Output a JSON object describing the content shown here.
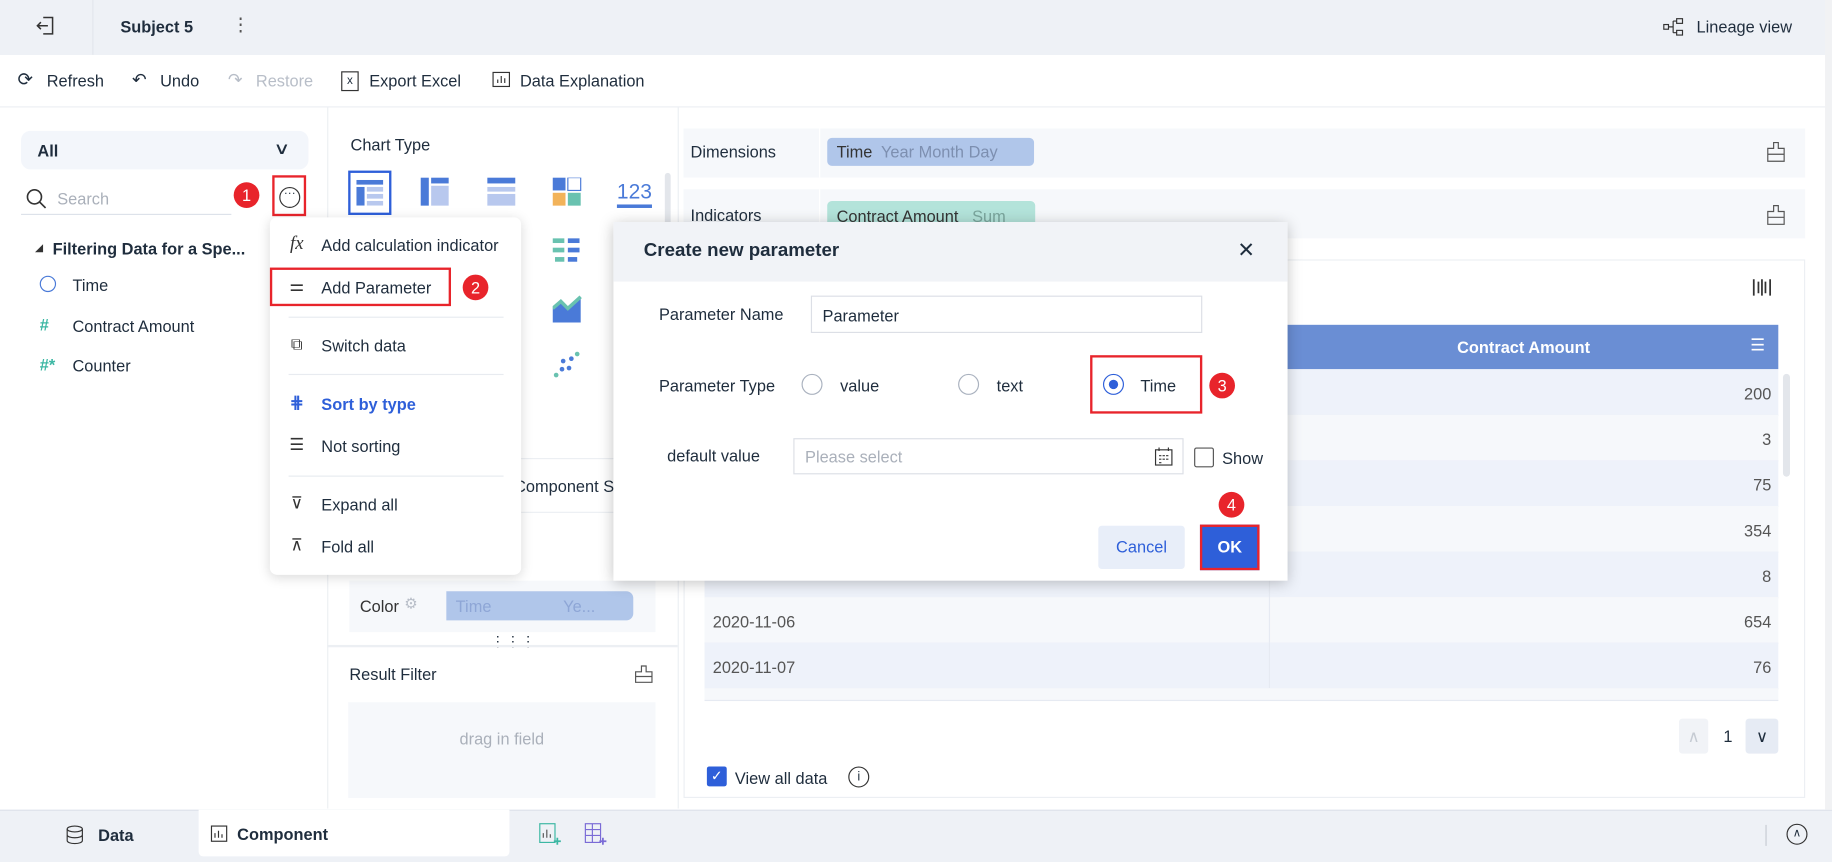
{
  "header": {
    "title": "Subject 5",
    "lineage_label": "Lineage view"
  },
  "toolbar": {
    "refresh": "Refresh",
    "undo": "Undo",
    "restore": "Restore",
    "export_excel": "Export Excel",
    "data_explanation": "Data Explanation"
  },
  "left": {
    "filter_select": "All",
    "search_placeholder": "Search",
    "group": "Filtering Data for a Spe...",
    "fields": [
      {
        "label": "Time",
        "icon": "clock-icon"
      },
      {
        "label": "Contract Amount",
        "icon": "hash-icon"
      },
      {
        "label": "Counter",
        "icon": "hash-star-icon"
      }
    ]
  },
  "menu": {
    "items": [
      "Add calculation indicator",
      "Add Parameter",
      "Switch data",
      "Sort by type",
      "Not sorting",
      "Expand all",
      "Fold all"
    ]
  },
  "steps": [
    "1",
    "2",
    "3",
    "4"
  ],
  "middle": {
    "chart_type_label": "Chart Type",
    "number_icon_text": "123",
    "component_tab": "Component S",
    "color_label": "Color",
    "color_pill": {
      "field": "Time",
      "sub": "Ye..."
    },
    "result_filter": "Result Filter",
    "drag_placeholder": "drag in field"
  },
  "fields_area": {
    "dimensions_label": "Dimensions",
    "dimension_pill": {
      "field": "Time",
      "sub": "Year Month Day"
    },
    "indicators_label": "Indicators",
    "indicator_pill": {
      "field": "Contract Amount",
      "sub": "Sum"
    }
  },
  "table": {
    "header": "Contract Amount",
    "rows": [
      {
        "date": "",
        "value": "200"
      },
      {
        "date": "",
        "value": "3"
      },
      {
        "date": "",
        "value": "75"
      },
      {
        "date": "",
        "value": "354"
      },
      {
        "date": "",
        "value": "8"
      },
      {
        "date": "2020-11-06",
        "value": "654"
      },
      {
        "date": "2020-11-07",
        "value": "76"
      }
    ],
    "page": "1",
    "view_all_label": "View all data",
    "view_all_checked": true
  },
  "modal": {
    "title": "Create new parameter",
    "name_label": "Parameter Name",
    "name_value": "Parameter",
    "type_label": "Parameter Type",
    "type_options": [
      "value",
      "text",
      "Time"
    ],
    "type_selected": "Time",
    "default_label": "default value",
    "default_placeholder": "Please select",
    "show_label": "Show",
    "cancel": "Cancel",
    "ok": "OK"
  },
  "bottom": {
    "data_tab": "Data",
    "component_tab": "Component"
  },
  "colors": {
    "accent": "#2e5fd9",
    "header_blue": "#6a8ed4",
    "step_red": "#e8242b",
    "dim_pill": "#b0c6ea",
    "ind_pill": "#b3e3da"
  }
}
